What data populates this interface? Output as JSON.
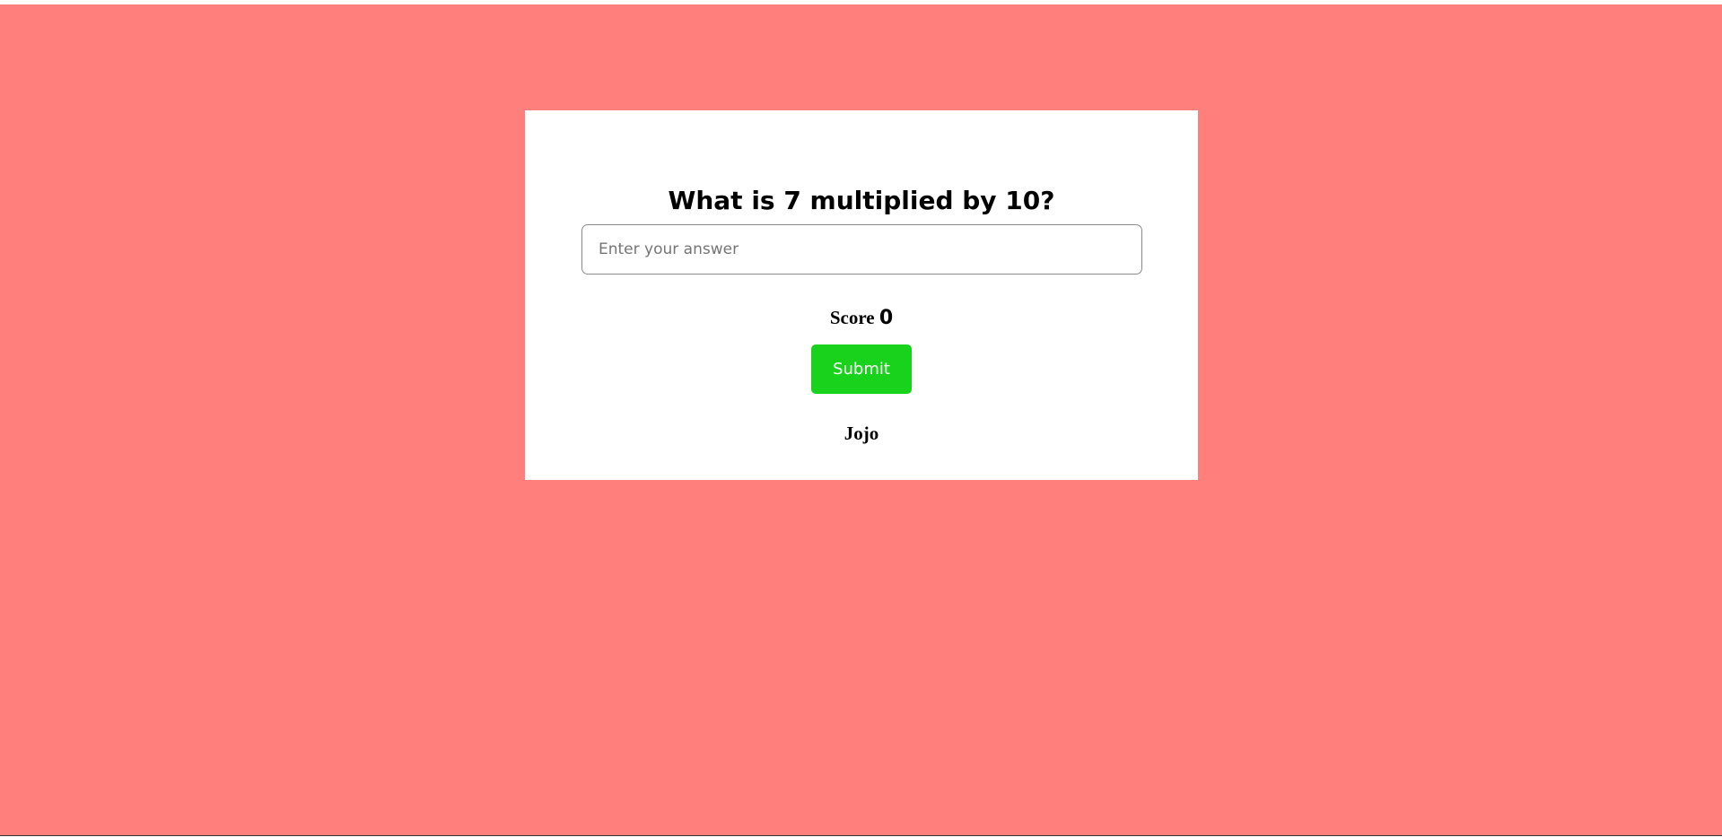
{
  "quiz": {
    "question": "What is 7 multiplied by 10?",
    "answer_placeholder": "Enter your answer",
    "answer_value": "",
    "score_label": "Score",
    "score_value": "0",
    "submit_label": "Submit",
    "player_name": "Jojo"
  },
  "colors": {
    "page_background": "#ff7f7d",
    "card_background": "#ffffff",
    "submit_background": "#18d21b",
    "submit_text": "#ffffff"
  }
}
